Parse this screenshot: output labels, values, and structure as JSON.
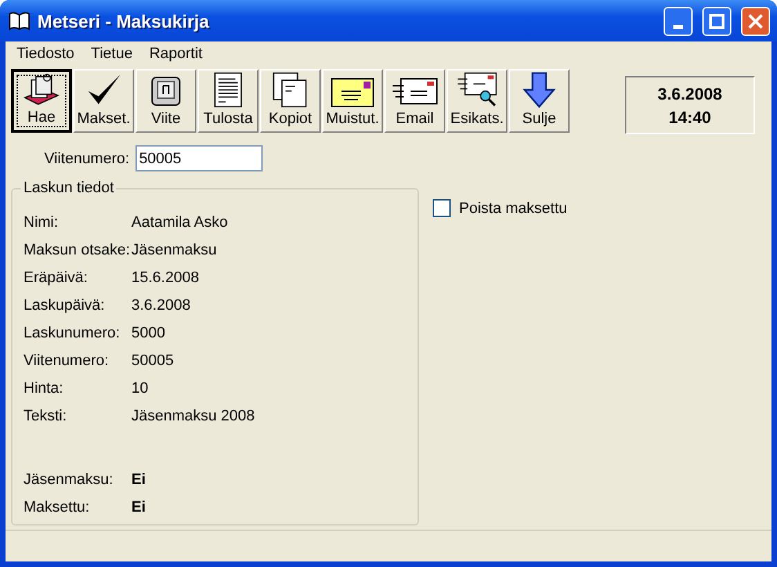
{
  "window": {
    "title": "Metseri - Maksukirja"
  },
  "menu": [
    {
      "label": "Tiedosto"
    },
    {
      "label": "Tietue"
    },
    {
      "label": "Raportit"
    }
  ],
  "toolbar": [
    {
      "label": "Hae",
      "selected": true
    },
    {
      "label": "Makset.",
      "selected": false
    },
    {
      "label": "Viite",
      "selected": false
    },
    {
      "label": "Tulosta",
      "selected": false
    },
    {
      "label": "Kopiot",
      "selected": false
    },
    {
      "label": "Muistut.",
      "selected": false
    },
    {
      "label": "Email",
      "selected": false
    },
    {
      "label": "Esikats.",
      "selected": false
    },
    {
      "label": "Sulje",
      "selected": false
    }
  ],
  "clock": {
    "date": "3.6.2008",
    "time": "14:40"
  },
  "reference": {
    "label": "Viitenumero:",
    "value": "50005"
  },
  "invoice": {
    "title": "Laskun tiedot",
    "fields": [
      {
        "label": "Nimi:",
        "value": "Aatamila Asko"
      },
      {
        "label": "Maksun otsake:",
        "value": "Jäsenmaksu"
      },
      {
        "label": "Eräpäivä:",
        "value": "15.6.2008"
      },
      {
        "label": "Laskupäivä:",
        "value": "3.6.2008"
      },
      {
        "label": "Laskunumero:",
        "value": "5000"
      },
      {
        "label": "Viitenumero:",
        "value": "50005"
      },
      {
        "label": "Hinta:",
        "value": "10"
      },
      {
        "label": "Teksti:",
        "value": "Jäsenmaksu 2008"
      }
    ],
    "flags": [
      {
        "label": "Jäsenmaksu:",
        "value": "Ei"
      },
      {
        "label": "Maksettu:",
        "value": "Ei"
      }
    ]
  },
  "remove_paid": {
    "label": "Poista maksettu",
    "checked": false
  }
}
